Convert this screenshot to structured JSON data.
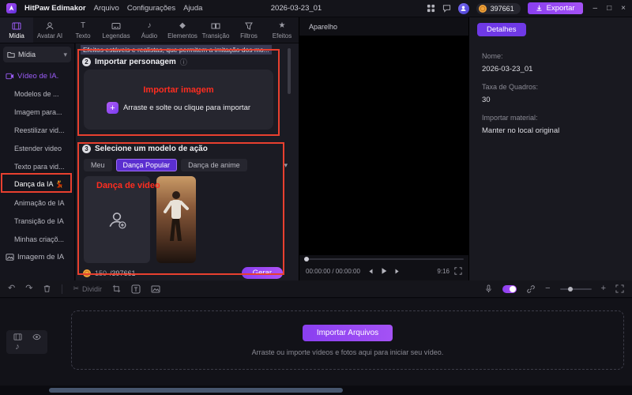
{
  "titlebar": {
    "app_name": "HitPaw Edimakor",
    "menus": [
      "Arquivo",
      "Configurações",
      "Ajuda"
    ],
    "project_title": "2026-03-23_01",
    "credits_badge": "397661",
    "export_label": "Exportar",
    "window": {
      "minimize": "–",
      "maximize": "□",
      "close": "×"
    }
  },
  "ribbon": {
    "tabs": [
      {
        "label": "Mídia"
      },
      {
        "label": "Avatar AI"
      },
      {
        "label": "Texto"
      },
      {
        "label": "Legendas"
      },
      {
        "label": "Áudio"
      },
      {
        "label": "Elementos"
      },
      {
        "label": "Transição"
      },
      {
        "label": "Filtros"
      },
      {
        "label": "Efeitos"
      }
    ]
  },
  "sidebar": {
    "media_dropdown": "Mídia",
    "video_ai_section": "Vídeo de IA.",
    "items": [
      "Modelos de ...",
      "Imagem para...",
      "Reestilizar vid...",
      "Estender video",
      "Texto para vid...",
      "Dança da IA 💃",
      "Animação de IA",
      "Transição de IA",
      "Minhas criaçõ..."
    ],
    "image_ai_section": "Imagem de IA"
  },
  "panel": {
    "description": "Efeitos estáveis e realistas, que permitem a imitação dos mo...",
    "step2": {
      "badge": "2",
      "title": "Importar personagem"
    },
    "import_area": {
      "annotation": "Importar imagem",
      "drop_label": "Arraste e solte ou clique para importar"
    },
    "step3": {
      "badge": "3",
      "title": "Selecione um modelo de ação"
    },
    "model_tabs": [
      {
        "label": "Meu"
      },
      {
        "label": "Dança Popular"
      },
      {
        "label": "Dança de anime"
      }
    ],
    "card_annotation": "Dança de video",
    "footer": {
      "cost": "150",
      "balance": "/397661",
      "generate_label": "Gerar"
    }
  },
  "preview": {
    "device_label": "Aparelho",
    "time": "00:00:00 / 00:00:00",
    "ratio": "9:16"
  },
  "details": {
    "tab_label": "Detalhes",
    "fields": [
      {
        "label": "Nome:",
        "value": "2026-03-23_01"
      },
      {
        "label": "Taxa de Quadros:",
        "value": "30"
      },
      {
        "label": "Importar material:",
        "value": "Manter no local original"
      }
    ]
  },
  "toolbar": {
    "split_label": "Dividir"
  },
  "timeline": {
    "import_button": "Importar Arquivos",
    "hint": "Arraste ou importe vídeos e fotos aqui para iniciar seu vídeo."
  },
  "glyphs": {
    "chevron_down": "▾",
    "undo": "↶",
    "redo": "↷",
    "scissors": "✂",
    "minus": "−",
    "plus": "+",
    "note": "♪",
    "diamond": "◆",
    "star": "★",
    "letter_t": "T",
    "info": "ⓘ"
  },
  "colors": {
    "accent_purple": "#8b46f0",
    "annotation_red": "#e8402f",
    "coin_orange": "#f2a33c"
  }
}
